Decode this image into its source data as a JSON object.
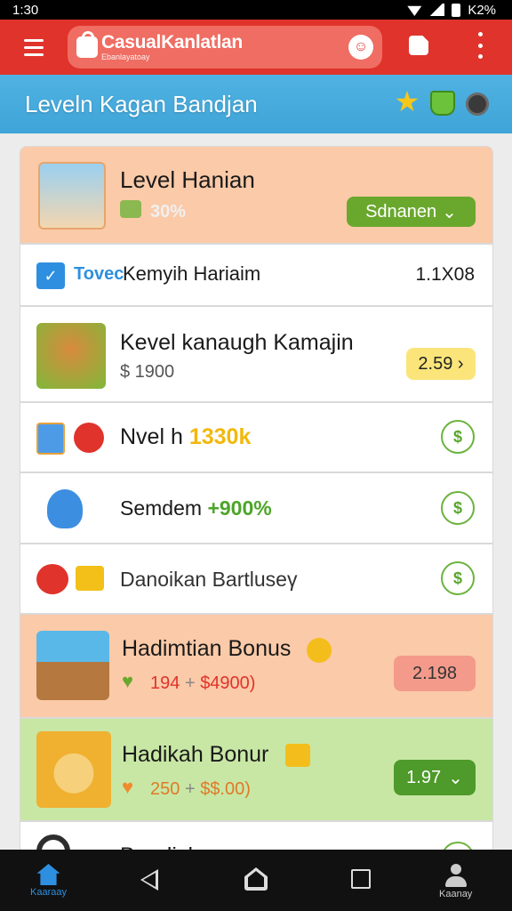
{
  "status": {
    "time": "1:30",
    "battery": "K2%"
  },
  "appbar": {
    "search_title": "CasualKanlatlan",
    "search_subtitle": "Ebanlayatoay"
  },
  "level_header": {
    "title": "Leveln Kagan Bandjan"
  },
  "rows": [
    {
      "title": "Level Hanian",
      "sub": "30%",
      "dropdown": "Sdnanen"
    },
    {
      "brand": "Tovec",
      "title": "Kemyih Hariaim",
      "value": "1.1X08"
    },
    {
      "title": "Kevel kanaugh Kamajin",
      "sub": "$ 1900",
      "price": "2.59 ›"
    },
    {
      "title_a": "Nvel h",
      "title_b": "1330k",
      "btn": "$"
    },
    {
      "title_a": "Semdem",
      "title_b": "+900%",
      "btn": "$"
    },
    {
      "title": "Danoikan Bartluseγ",
      "btn": "$"
    },
    {
      "title": "Hadimtian Bonus",
      "sub_a": "194",
      "sub_b": "+",
      "sub_c": "$4900)",
      "price": "2.198"
    },
    {
      "title": "Hadikah Bonur",
      "sub_a": "250",
      "sub_b": "+",
      "sub_c": "$$.00)",
      "price": "1.97"
    },
    {
      "title": "Bandisk..",
      "btn": "$"
    }
  ],
  "nav": {
    "home_label": "Kaaraay",
    "profile_label": "Kaanay"
  },
  "colors": {
    "appbar": "#e0332b",
    "header": "#4fb2e2",
    "accent_green": "#6cb33f"
  }
}
